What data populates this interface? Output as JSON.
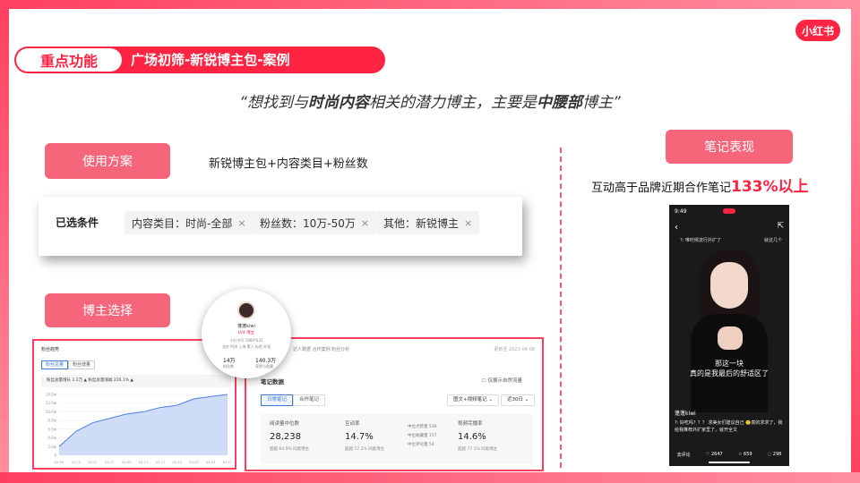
{
  "brand": {
    "logo_text": "小红书",
    "accent": "#ff2442",
    "button_color": "#f6667a"
  },
  "header": {
    "key_label": "重点功能",
    "title": "广场初筛-新锐博主包-案例"
  },
  "quote": {
    "open": "“想找到与",
    "em1": "时尚内容",
    "mid": "相关的潜力博主，主要是",
    "em2": "中腰部",
    "close": "博主”"
  },
  "plan": {
    "button_label": "使用方案",
    "text": "新锐博主包+内容类目+粉丝数"
  },
  "conditions": {
    "label": "已选条件",
    "chips": [
      {
        "text": "内容类目：时尚-全部",
        "close": "×"
      },
      {
        "text": "粉丝数：10万-50万",
        "close": "×"
      },
      {
        "text": "其他：新锐博主",
        "close": "×"
      }
    ]
  },
  "blogger_select": {
    "button_label": "博主选择"
  },
  "note_perf": {
    "button_label": "笔记表现",
    "caption_pre": "互动高于品牌近期合作笔记",
    "caption_value": "133%",
    "caption_post": "以上"
  },
  "phone": {
    "time": "9:49",
    "top_left_text": "?: 唯时候流行外扩了",
    "top_right_text": "就这几个",
    "subtitle_line1": "那这一块",
    "subtitle_line2": "真的是我最后的舒适区了",
    "user": "蓬蓬kiwi",
    "comments": "?: 好吃吗？？？ 求美女们建议自己 🙂真的求求了，我给我推荐外扩家里了，就开全文",
    "input_placeholder": "去评论",
    "likes": "2647",
    "stars": "659",
    "comment_count": "298"
  },
  "trend_panel": {
    "title": "粉丝趋势",
    "tabs": [
      "粉丝总量",
      "粉丝增量"
    ],
    "stats": "粉丝总量增长 3.2万  ▲      粉丝总量涨幅 226.1%  ▲",
    "y_ticks": [
      "14.0w",
      "12.0w",
      "10.0w",
      "8.0w",
      "6.0w",
      "4.0w",
      "2.0w",
      "0"
    ],
    "x_ticks": [
      "02-09",
      "02-15",
      "02-21",
      "02-27",
      "03-05",
      "03-11",
      "03-17",
      "03-23",
      "03-29",
      "04-04",
      "04-10"
    ]
  },
  "chart_data": {
    "type": "area",
    "title": "粉丝趋势",
    "x": [
      "02-09",
      "02-15",
      "02-21",
      "02-27",
      "03-05",
      "03-11",
      "03-17",
      "03-23",
      "03-29",
      "04-04",
      "04-10"
    ],
    "series": [
      {
        "values": [
          2.0,
          5.5,
          7.5,
          8.5,
          9.5,
          10.0,
          11.0,
          11.5,
          13.0,
          13.5,
          14.0
        ]
      }
    ],
    "ylim": [
      0,
      14
    ],
    "grid": true
  },
  "notes_panel": {
    "top_tabs": "达人数据  合作案例  粉丝分析",
    "date": "更新至 2023-04-08",
    "title": "笔记数据",
    "checkbox": "仅展示自然流量",
    "tabs": [
      "日常笔记",
      "合作笔记"
    ],
    "selects": [
      "图文+视频笔记 ⌄",
      "近30日 ⌄"
    ],
    "metrics": [
      {
        "label": "阅读量中位数",
        "value": "28,238",
        "sub": "超越 84.9% 同类博主"
      },
      {
        "label": "互动率",
        "value": "14.7%",
        "sub": "超越 57.2% 同类博主"
      },
      {
        "label": "视频完播率",
        "value": "14.6%",
        "sub": "超越 77.1% 同类博主"
      }
    ],
    "sub_metrics": [
      "中位点赞量  530",
      "中位收藏量  157",
      "中位评论量  54"
    ]
  },
  "profile": {
    "name": "蓬蓬kiwi",
    "level": "LV4 博主",
    "info_line1": "小红书号 1960*632",
    "info_line2": "北京 时尚 上海 素人   标签 外观",
    "stat1_value": "14万",
    "stat1_label": "粉丝数",
    "stat2_value": "140.3万",
    "stat2_label": "获赞与收藏"
  }
}
